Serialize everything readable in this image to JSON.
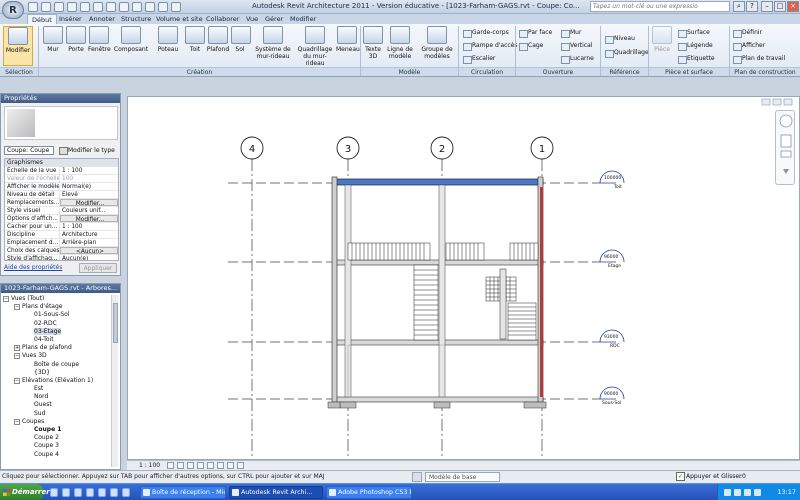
{
  "window": {
    "title": "Autodesk Revit Architecture 2011 - Version éducative - [1023-Farham-GAGS.rvt - Coupe: Co...",
    "search_placeholder": "Tapez un mot-clé ou une expressio",
    "app_button": "R"
  },
  "ribbon": {
    "tabs": [
      "Début",
      "Insérer",
      "Annoter",
      "Structure",
      "Volume et site",
      "Collaborer",
      "Vue",
      "Gérer",
      "Modifier"
    ],
    "active_tab": "Début",
    "buttons": {
      "modifier": "Modifier",
      "mur": "Mur",
      "porte": "Porte",
      "fenetre": "Fenêtre",
      "composant": "Composant",
      "poteau": "Poteau",
      "toit": "Toit",
      "plafond": "Plafond",
      "sol": "Sol",
      "systeme": "Système de mur-rideau",
      "quadrillage_mur": "Quadrillage du mur-rideau",
      "meneau": "Meneau",
      "texte3d": "Texte 3D",
      "ligne_modele": "Ligne de modèle",
      "groupe_modeles": "Groupe de modèles",
      "garde_corps": "Garde-corps",
      "rampe": "Rampe d'accès",
      "escalier": "Escalier",
      "par_face": "Par face",
      "cage": "Cage",
      "mur_small": "Mur",
      "vertical": "Vertical",
      "lucarne": "Lucarne",
      "niveau": "Niveau",
      "quadrillage": "Quadrillage",
      "piece": "Pièce",
      "surface": "Surface",
      "legende": "Légende",
      "etiquette": "Etiquette",
      "definir": "Définir",
      "afficher": "Afficher",
      "plan_travail": "Plan de travail"
    },
    "panels": {
      "selection": "Sélection",
      "creation": "Création",
      "modele": "Modèle",
      "circulation": "Circulation",
      "ouverture": "Ouverture",
      "reference": "Référence",
      "piece_surface": "Pièce et surface",
      "plan_construction": "Plan de construction"
    }
  },
  "properties": {
    "title": "Propriétés",
    "type_selector": "Coupe: Coupe",
    "edit_type": "Modifier le type",
    "group": "Graphismes",
    "rows": [
      {
        "name": "Echelle de la vue",
        "value": "1 : 100",
        "dim": false
      },
      {
        "name": "Valeur de l'échelle",
        "value": "100",
        "dim": true
      },
      {
        "name": "Afficher le modèle",
        "value": "Normal(e)",
        "dim": false
      },
      {
        "name": "Niveau de détail",
        "value": "Elevé",
        "dim": false
      },
      {
        "name": "Remplacements...",
        "value": "Modifier...",
        "dim": false,
        "btn": true
      },
      {
        "name": "Style visuel",
        "value": "Couleurs unif...",
        "dim": false
      },
      {
        "name": "Options d'affich...",
        "value": "Modifier...",
        "dim": false,
        "btn": true
      },
      {
        "name": "Cacher pour un...",
        "value": "1 : 100",
        "dim": false
      },
      {
        "name": "Discipline",
        "value": "Architecture",
        "dim": false
      },
      {
        "name": "Emplacement d...",
        "value": "Arrière-plan",
        "dim": false
      },
      {
        "name": "Choix des calques",
        "value": "<Aucun>",
        "dim": false,
        "btn": true
      },
      {
        "name": "Style d'affichag...",
        "value": "Aucun(e)",
        "dim": false
      }
    ],
    "help_link": "Aide des propriétés",
    "apply": "Appliquer"
  },
  "browser": {
    "title": "1023-Farham-GAGS.rvt - Arbores...",
    "tree": [
      {
        "label": "Vues (Tout)",
        "level": 0,
        "toggle": "−",
        "bold": false
      },
      {
        "label": "Plans d'étage",
        "level": 1,
        "toggle": "−",
        "bold": false
      },
      {
        "label": "01-Sous-Sol",
        "level": 2,
        "toggle": "",
        "bold": false
      },
      {
        "label": "02-RDC",
        "level": 2,
        "toggle": "",
        "bold": false
      },
      {
        "label": "03-Etage",
        "level": 2,
        "toggle": "",
        "bold": false,
        "sel": true
      },
      {
        "label": "04-Toit",
        "level": 2,
        "toggle": "",
        "bold": false
      },
      {
        "label": "Plans de plafond",
        "level": 1,
        "toggle": "+",
        "bold": false
      },
      {
        "label": "Vues 3D",
        "level": 1,
        "toggle": "−",
        "bold": false
      },
      {
        "label": "Boîte de coupe",
        "level": 2,
        "toggle": "",
        "bold": false
      },
      {
        "label": "{3D}",
        "level": 2,
        "toggle": "",
        "bold": false
      },
      {
        "label": "Elévations (Elévation 1)",
        "level": 1,
        "toggle": "−",
        "bold": false
      },
      {
        "label": "Est",
        "level": 2,
        "toggle": "",
        "bold": false
      },
      {
        "label": "Nord",
        "level": 2,
        "toggle": "",
        "bold": false
      },
      {
        "label": "Ouest",
        "level": 2,
        "toggle": "",
        "bold": false
      },
      {
        "label": "Sud",
        "level": 2,
        "toggle": "",
        "bold": false
      },
      {
        "label": "Coupes",
        "level": 1,
        "toggle": "−",
        "bold": false
      },
      {
        "label": "Coupe 1",
        "level": 2,
        "toggle": "",
        "bold": true
      },
      {
        "label": "Coupe 2",
        "level": 2,
        "toggle": "",
        "bold": false
      },
      {
        "label": "Coupe 3",
        "level": 2,
        "toggle": "",
        "bold": false
      },
      {
        "label": "Coupe 4",
        "level": 2,
        "toggle": "",
        "bold": false
      }
    ]
  },
  "drawing": {
    "grid_labels": [
      "4",
      "3",
      "2",
      "1"
    ],
    "levels": [
      {
        "value": "100000",
        "name": "Toit"
      },
      {
        "value": "96000",
        "name": "Etage"
      },
      {
        "value": "93000",
        "name": "RDC"
      },
      {
        "value": "90000",
        "name": "Sous-Sol"
      }
    ]
  },
  "viewbar": {
    "scale": "1 : 100"
  },
  "status": {
    "text": "Cliquez pour sélectionner. Appuyez sur TAB pour afficher d'autres options, sur CTRL pour ajouter et sur MAJ",
    "workset": "Modèle de base",
    "press_drag": "Appuyer et Glisser",
    "filter_count": ":0"
  },
  "taskbar": {
    "start": "Démarrer",
    "tasks": [
      {
        "label": "Boîte de réception - Micr...",
        "active": false
      },
      {
        "label": "Autodesk Revit Archi...",
        "active": true
      },
      {
        "label": "Adobe Photoshop CS3 E...",
        "active": false
      }
    ],
    "clock": "13:17"
  }
}
